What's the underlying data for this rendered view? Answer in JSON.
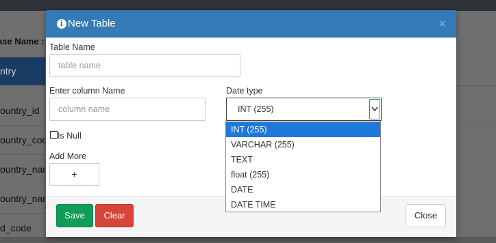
{
  "background": {
    "db_name_label": "ase Name : I",
    "table_header": "ntry",
    "rows": [
      "ountry_id",
      "ountry_code",
      "ountry_name",
      "ountry_name",
      "d_code"
    ]
  },
  "modal": {
    "title": "New Table",
    "close_x": "×",
    "table_name": {
      "label": "Table Name",
      "placeholder": "table name",
      "value": ""
    },
    "column_name": {
      "label": "Enter column Name",
      "placeholder": "column name",
      "value": ""
    },
    "data_type": {
      "label": "Date type",
      "selected": "INT (255)"
    },
    "is_null_label": "Is Null",
    "add_more": {
      "label": "Add More",
      "button": "+"
    },
    "dropdown_options": [
      "INT (255)",
      "VARCHAR (255)",
      "TEXT",
      "float (255)",
      "DATE",
      "DATE TIME"
    ],
    "footer": {
      "save": "Save",
      "clear": "Clear",
      "close": "Close"
    },
    "colors": {
      "header": "#337ab7",
      "save": "#0f9d58",
      "clear": "#d9443a",
      "dropdown_highlight": "#1e78d7"
    }
  }
}
